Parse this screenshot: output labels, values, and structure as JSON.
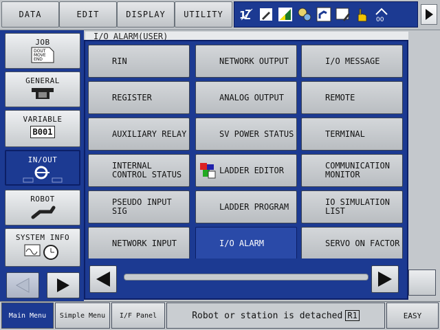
{
  "top_menu": {
    "data": "DATA",
    "edit": "EDIT",
    "display": "DISPLAY",
    "utility": "UTILITY"
  },
  "status_icons": [
    "twelve-icon",
    "edit-mode-icon",
    "signal-icon",
    "gear-icon",
    "robot-icon",
    "monitor-icon",
    "hand-icon",
    "toolset-icon"
  ],
  "left_menu": {
    "job": {
      "label": "JOB",
      "icon_text": "DOUT\nMOVE\nEND"
    },
    "general": {
      "label": "GENERAL"
    },
    "variable": {
      "label": "VARIABLE",
      "value": "B001"
    },
    "inout": {
      "label": "IN/OUT"
    },
    "robot": {
      "label": "ROBOT"
    },
    "system_info": {
      "label": "SYSTEM INFO"
    }
  },
  "panel_title": "I/O ALARM(USER)",
  "grid": [
    "RIN",
    "NETWORK OUTPUT",
    "I/O MESSAGE",
    "REGISTER",
    "ANALOG OUTPUT",
    "REMOTE",
    "AUXILIARY RELAY",
    "SV POWER STATUS",
    "TERMINAL",
    "INTERNAL\nCONTROL STATUS",
    "LADDER EDITOR",
    "COMMUNICATION\nMONITOR",
    "PSEUDO INPUT\nSIG",
    "LADDER PROGRAM",
    "IO SIMULATION\nLIST",
    "NETWORK INPUT",
    "I/O ALARM",
    "SERVO ON FACTOR"
  ],
  "selected_item": "I/O ALARM",
  "bottom": {
    "main_menu": "Main Menu",
    "simple_menu": "Simple Menu",
    "if_panel": "I/F Panel",
    "message": "Robot or station is detached",
    "message_tag": "R1",
    "easy": "EASY"
  },
  "colors": {
    "accent_blue": "#1c3a92",
    "button_gray": "#c6cacd"
  }
}
